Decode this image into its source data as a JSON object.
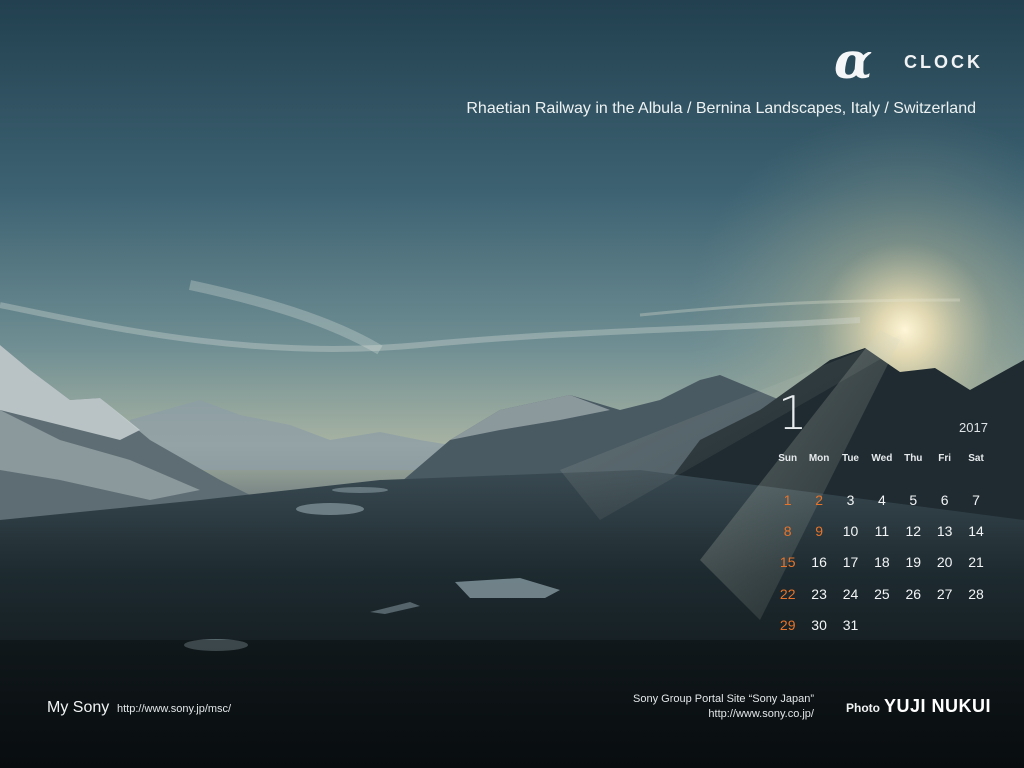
{
  "brand": {
    "logo_glyph": "α",
    "title": "CLOCK"
  },
  "caption": "Rhaetian Railway in the Albula / Bernina Landscapes, Italy / Switzerland",
  "calendar": {
    "month": "1",
    "year": "2017",
    "weekdays": [
      "Sun",
      "Mon",
      "Tue",
      "Wed",
      "Thu",
      "Fri",
      "Sat"
    ],
    "weeks": [
      [
        "1",
        "2",
        "3",
        "4",
        "5",
        "6",
        "7"
      ],
      [
        "8",
        "9",
        "10",
        "11",
        "12",
        "13",
        "14"
      ],
      [
        "15",
        "16",
        "17",
        "18",
        "19",
        "20",
        "21"
      ],
      [
        "22",
        "23",
        "24",
        "25",
        "26",
        "27",
        "28"
      ],
      [
        "29",
        "30",
        "31",
        "",
        "",
        "",
        ""
      ]
    ],
    "holidays": [
      "2",
      "9"
    ],
    "holiday_color": "#e8742a"
  },
  "footer": {
    "my_sony": "My Sony",
    "my_sony_url": "http://www.sony.jp/msc/",
    "portal_label": "Sony Group Portal Site “Sony Japan”",
    "portal_url": "http://www.sony.co.jp/",
    "photo_label": "Photo",
    "photographer": "YUJI NUKUI"
  }
}
